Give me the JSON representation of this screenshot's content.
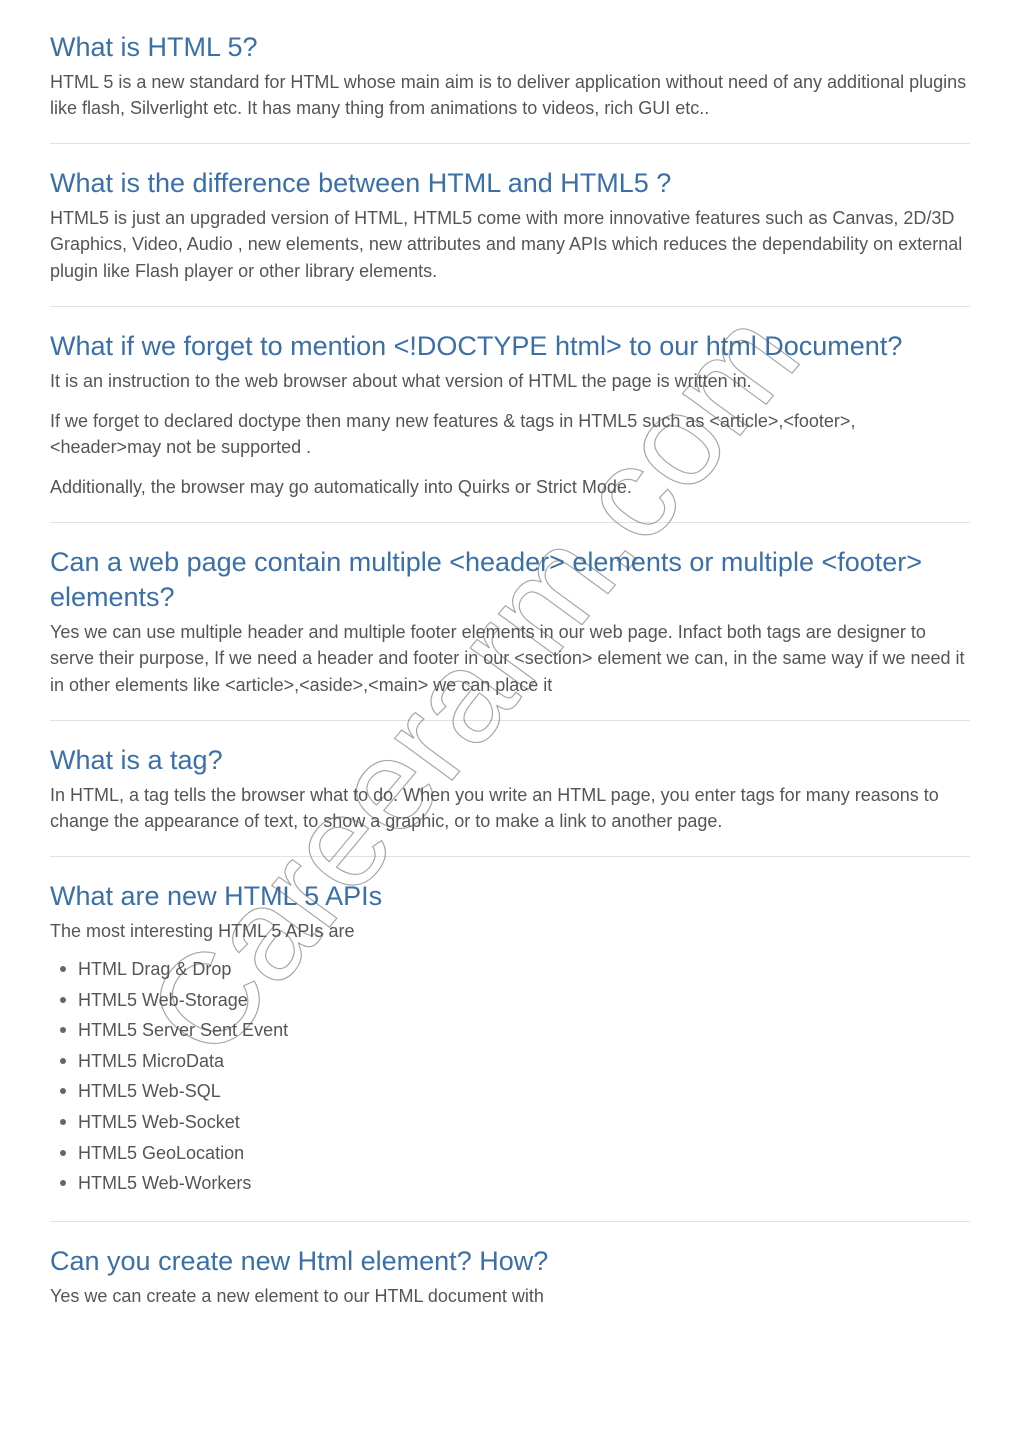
{
  "watermark": "Careerarm.com",
  "sections": [
    {
      "heading": "What is HTML 5?",
      "paragraphs": [
        "HTML 5 is a new standard for HTML whose main aim is to deliver application without need of any additional plugins like flash, Silverlight etc. It has many thing from animations to videos, rich GUI etc.."
      ]
    },
    {
      "heading": "What is the difference between HTML and HTML5 ?",
      "paragraphs": [
        "HTML5 is just an upgraded version of HTML, HTML5 come with more innovative features such as Canvas, 2D/3D Graphics, Video, Audio , new elements, new attributes and many APIs which reduces the dependability on external plugin like Flash player or other library elements."
      ]
    },
    {
      "heading": "What if we forget to mention <!DOCTYPE html> to our html Document?",
      "paragraphs": [
        "It is an instruction to the web browser about what version of HTML the page is written in.",
        "If we forget to declared doctype then many new features & tags in HTML5 such as <article>,<footer>, <header>may not be supported .",
        "Additionally, the browser may go automatically into Quirks or Strict Mode."
      ]
    },
    {
      "heading": "Can a web page contain multiple <header> elements or multiple <footer> elements?",
      "paragraphs": [
        "Yes we can use multiple header and multiple footer elements in our web page. Infact both tags are designer to serve their purpose, If we need a header and footer in our <section> element we can, in the same way if we need it in other elements like <article>,<aside>,<main> we can place it"
      ]
    },
    {
      "heading": "What is a tag?",
      "paragraphs": [
        "In HTML, a tag tells the browser what to do. When you write an HTML page, you enter tags for many reasons to change the appearance of text, to show a graphic, or to make a link to another page."
      ]
    },
    {
      "heading": "What are new HTML 5 APIs",
      "paragraphs": [
        "The most interesting HTML 5 APIs are"
      ],
      "list": [
        "HTML Drag & Drop",
        "HTML5 Web-Storage",
        "HTML5 Server Sent Event",
        "HTML5 MicroData",
        "HTML5 Web-SQL",
        "HTML5 Web-Socket",
        "HTML5 GeoLocation",
        "HTML5 Web-Workers"
      ]
    },
    {
      "heading": "Can you create new Html element? How?",
      "paragraphs": [
        "Yes we can create a new element to our HTML document with"
      ]
    }
  ]
}
